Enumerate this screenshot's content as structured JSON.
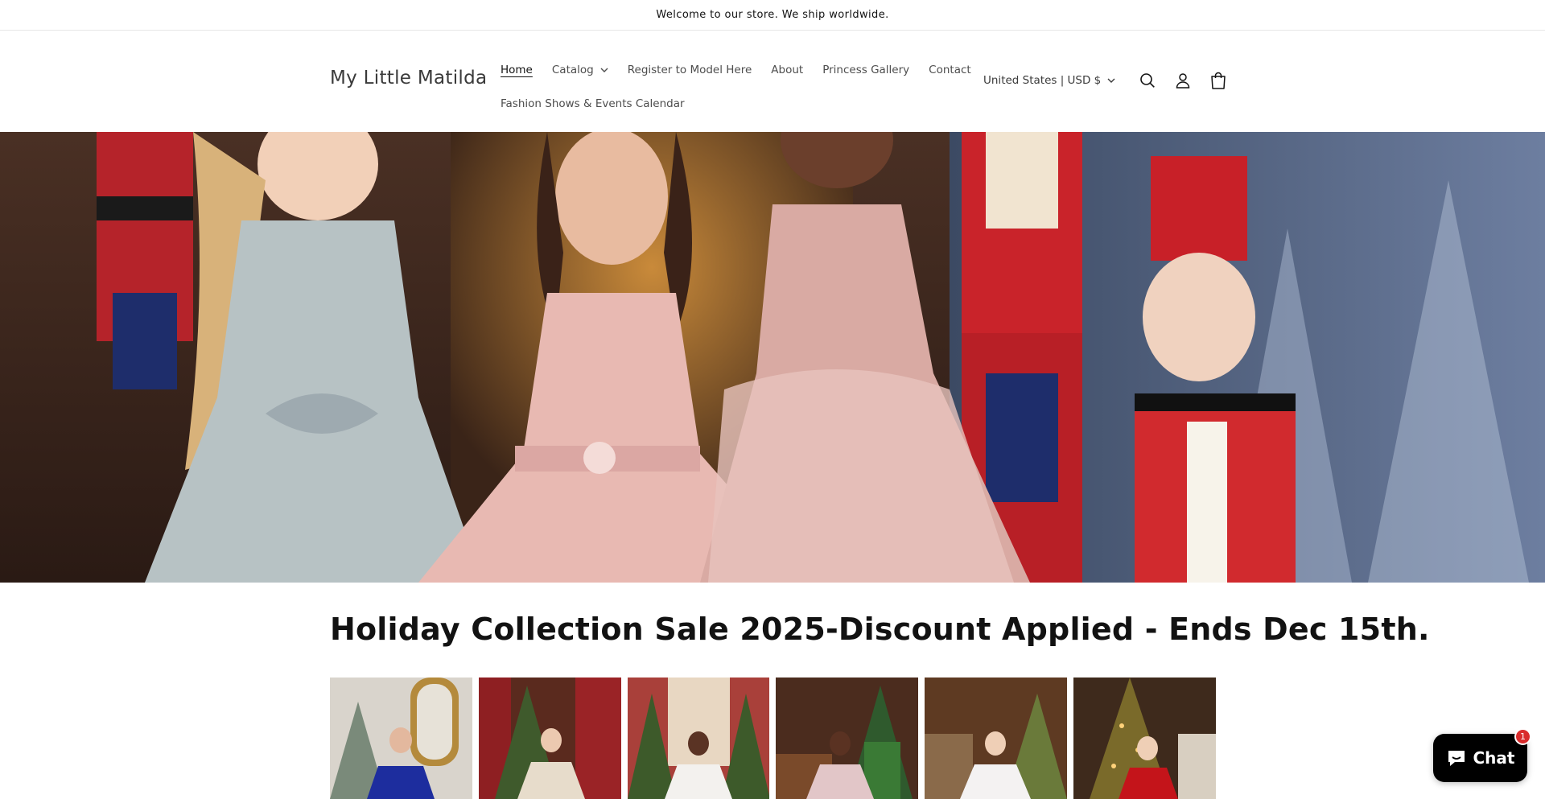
{
  "announcement": {
    "text": "Welcome to our store. We ship worldwide."
  },
  "header": {
    "logo": "My Little Matilda",
    "nav": {
      "row1": [
        {
          "label": "Home",
          "active": true
        },
        {
          "label": "Catalog",
          "has_dropdown": true
        },
        {
          "label": "Register to Model Here"
        },
        {
          "label": "About"
        },
        {
          "label": "Princess Gallery"
        },
        {
          "label": "Contact"
        }
      ],
      "row2": [
        {
          "label": "Fashion Shows & Events Calendar"
        }
      ]
    },
    "locale": "United States | USD $",
    "icons": [
      "search-icon",
      "account-icon",
      "cart-icon"
    ]
  },
  "hero": {
    "image": "holiday-girls-nutcracker-banner"
  },
  "sale": {
    "title": "Holiday Collection Sale 2025-Discount Applied - Ends Dec 15th."
  },
  "gallery": {
    "items": [
      {
        "image": "girl-blue-gown-mirror"
      },
      {
        "image": "girl-gold-dress-tree"
      },
      {
        "image": "girl-white-dress-chandelier"
      },
      {
        "image": "girl-pink-dress-elf"
      },
      {
        "image": "girl-white-dress-fireplace"
      },
      {
        "image": "girl-red-dress-tree"
      }
    ]
  },
  "chat": {
    "label": "Chat",
    "badge": "1"
  },
  "colors": {
    "text": "#121212",
    "nav_text": "#4d4d4d",
    "chat_bg": "#000000",
    "badge": "#d92c2c"
  }
}
